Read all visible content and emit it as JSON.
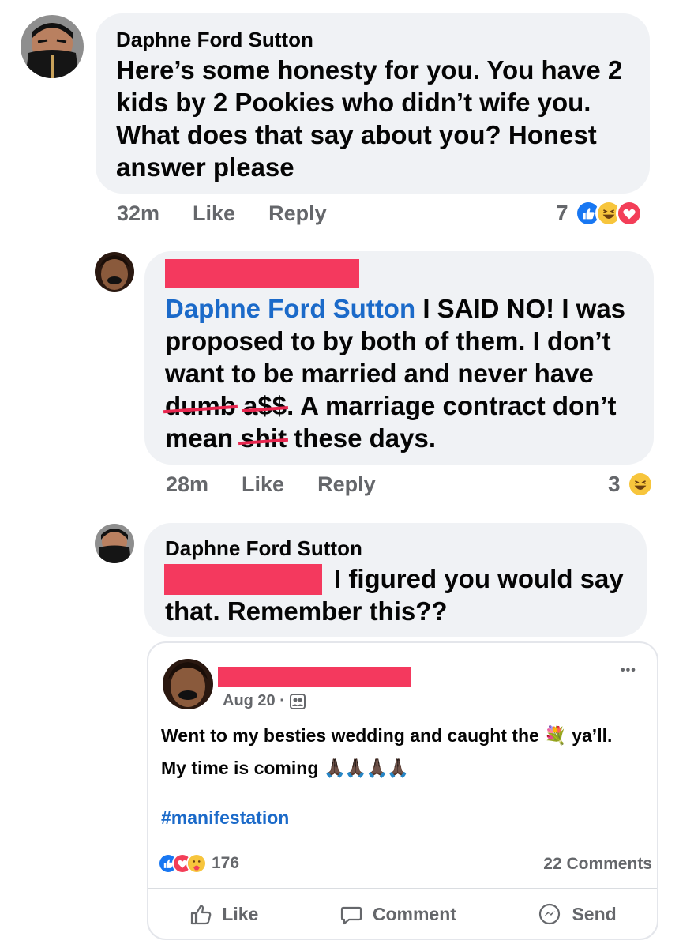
{
  "comments": [
    {
      "author": "Daphne Ford Sutton",
      "text": "Here’s some honesty for you. You have 2 kids by 2 Pookies who didn’t wife you. What does that say about you? Honest answer please",
      "time": "32m",
      "like_label": "Like",
      "reply_label": "Reply",
      "reaction_count": "7",
      "reaction_icons": [
        "like-icon",
        "haha-icon",
        "love-icon"
      ]
    },
    {
      "author": "",
      "mention": "Daphne Ford Sutton",
      "text_parts": [
        "I SAID NO! I was",
        "proposed to by both of them. I don’t",
        "want to be married and never have",
        "dumb",
        "a$$",
        ". A marriage contract don’t",
        "mean",
        "shit",
        "these days."
      ],
      "time": "28m",
      "like_label": "Like",
      "reply_label": "Reply",
      "reaction_count": "3",
      "reaction_icons": [
        "haha-icon"
      ]
    },
    {
      "author": "Daphne Ford Sutton",
      "text_line1": "I figured you would say",
      "text_line2": "that. Remember this??"
    }
  ],
  "shared_post": {
    "date": "Aug 20 ·",
    "audience_icon": "friends-icon",
    "line1_a": "Went to my besties wedding and caught the",
    "line1_emoji": "💐",
    "line1_b": "ya’ll.",
    "line2": "My time is coming",
    "line2_emoji": "🙏🏿🙏🏿🙏🏿🙏🏿",
    "hashtag": "#manifestation",
    "reaction_count": "176",
    "comments_count": "22 Comments",
    "more_label": "•••",
    "actions": [
      "Like",
      "Comment",
      "Send"
    ]
  },
  "colors": {
    "bubble": "#f0f2f5",
    "mention": "#1b6ac9",
    "redaction": "#f4395e",
    "meta": "#65676b"
  }
}
